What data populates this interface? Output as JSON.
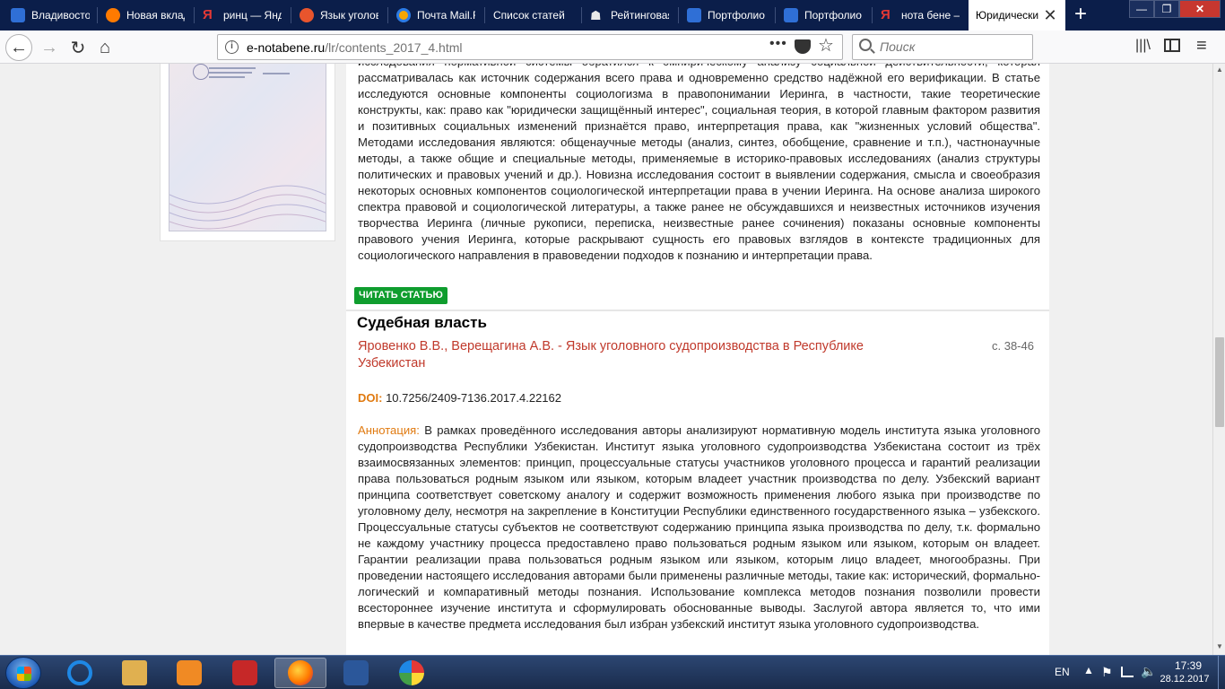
{
  "tabs": [
    {
      "label": "Владивосток",
      "icon": "spark-icon",
      "color": "#2f6fd6"
    },
    {
      "label": "Новая вкладка",
      "icon": "firefox-icon",
      "color": "#ff7a00"
    },
    {
      "label": "ринц — Яндекс",
      "icon": "yandex-icon",
      "color": "#e53935"
    },
    {
      "label": "Язык уголовного",
      "icon": "e-icon",
      "color": "#e8552d"
    },
    {
      "label": "Почта Mail.Ru",
      "icon": "mail-icon",
      "color": "#f7a600"
    },
    {
      "label": "Список статей",
      "icon": "list-icon",
      "color": "#5b6c8f"
    },
    {
      "label": "Рейтинговая",
      "icon": "people-icon",
      "color": "#e8e8e8"
    },
    {
      "label": "Портфолио",
      "icon": "spark-icon",
      "color": "#2f6fd6"
    },
    {
      "label": "Портфолио",
      "icon": "spark-icon",
      "color": "#2f6fd6"
    },
    {
      "label": "нота бене —",
      "icon": "yandex-icon",
      "color": "#e53935"
    },
    {
      "label": "Юридические",
      "icon": "",
      "color": ""
    }
  ],
  "nav": {
    "url_host": "e-notabene.ru",
    "url_path": "/lr/contents_2017_4.html",
    "search_placeholder": "Поиск",
    "more_label": "•••"
  },
  "article_prev": {
    "abstract": "исследования нормативной системы обратился к эмпирическому анализу социальной действительности, которая рассматривалась как источник содержания всего права и одновременно средство надёжной его верификации. В статье исследуются основные компоненты социологизма в правопонимании Иеринга, в частности, такие теоретические конструкты, как: право как \"юридически защищённый интерес\", социальная теория, в которой главным фактором развития и позитивных социальных изменений признаётся право, интерпретация права, как \"жизненных условий общества\". Методами исследования являются: общенаучные методы (анализ, синтез, обобщение, сравнение и т.п.), частнонаучные методы, а также общие и специальные методы, применяемые в историко-правовых исследованиях (анализ структуры политических и правовых учений и др.). Новизна исследования состоит в выявлении содержания, смысла и своеобразия некоторых основных компонентов социологической интерпретации права в учении Иеринга. На основе анализа широкого спектра правовой и социологической литературы, а также ранее не обсуждавшихся и неизвестных источников изучения творчества Иеринга (личные рукописи, переписка, неизвестные ранее сочинения) показаны основные компоненты правового учения Иеринга, которые раскрывают сущность его правовых взглядов в контексте традиционных для социологического направления в правоведении подходов к познанию и интерпретации права.",
    "read_button": "ЧИТАТЬ СТАТЬЮ"
  },
  "section": {
    "title": "Судебная власть"
  },
  "article": {
    "title": "Яровенко В.В., Верещагина А.В. - Язык уголовного судопроизводства в Республике Узбекистан",
    "pages": "с. 38-46",
    "doi_label": "DOI:",
    "doi": "10.7256/2409-7136.2017.4.22162",
    "abstract_label": "Аннотация:",
    "abstract": "В рамках проведённого исследования авторы анализируют нормативную модель института языка уголовного судопроизводства Республики Узбекистан. Институт языка уголовного судопроизводства Узбекистана состоит из трёх взаимосвязанных элементов: принцип, процессуальные статусы участников уголовного процесса и гарантий реализации права пользоваться родным языком или языком, которым владеет участник производства по делу. Узбекский вариант принципа соответствует советскому аналогу и содержит возможность применения любого языка при производстве по уголовному делу, несмотря на закрепление в Конституции Республики единственного государственного языка – узбекского. Процессуальные статусы субъектов не соответствуют содержанию принципа языка производства по делу, т.к. формально не каждому участнику процесса предоставлено право пользоваться родным языком или языком, которым он владеет. Гарантии реализации права пользоваться родным языком или языком, которым лицо владеет, многообразны. При проведении настоящего исследования авторами были применены различные методы, такие как: исторический, формально-логический и компаративный методы познания. Использование комплекса методов познания позволили провести всестороннее изучение института и сформулировать обоснованные выводы. Заслугой автора является то, что ими впервые в качестве предмета исследования был избран узбекский институт языка уголовного судопроизводства."
  },
  "taskbar": {
    "apps": [
      {
        "name": "internet-explorer",
        "color": "#1e88e5"
      },
      {
        "name": "file-explorer",
        "color": "#e0b050"
      },
      {
        "name": "media-player",
        "color": "#f08a24"
      },
      {
        "name": "acrobat-reader",
        "color": "#c62828"
      },
      {
        "name": "firefox",
        "color": "#ff7a00"
      },
      {
        "name": "word",
        "color": "#2b579a"
      },
      {
        "name": "paint",
        "color": "#7cb342"
      }
    ],
    "lang": "EN",
    "time": "17:39",
    "date": "28.12.2017"
  }
}
